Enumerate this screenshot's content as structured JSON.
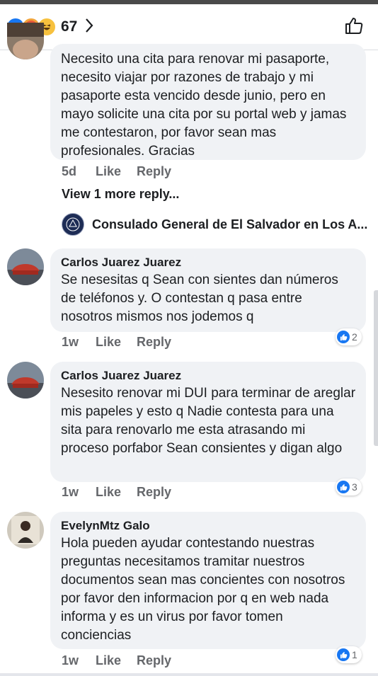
{
  "header": {
    "reaction_count": "67",
    "reactions": [
      "like-icon",
      "angry-icon",
      "haha-icon"
    ]
  },
  "comments": [
    {
      "text": "Necesito una cita para renovar mi pasaporte, necesito viajar por razones de trabajo y mi pasaporte esta vencido desde junio, pero en mayo solicite una cita por su portal web y jamas me contestaron, por favor sean mas profesionales. Gracias",
      "time": "5d",
      "like": "Like",
      "reply": "Reply"
    },
    {
      "author": "Carlos Juarez Juarez",
      "text": "Se nesesitas q Sean con sientes dan números de teléfonos y. O contestan q pasa entre nosotros mismos nos jodemos q",
      "time": "1w",
      "like": "Like",
      "reply": "Reply",
      "reactions": "2"
    },
    {
      "author": "Carlos Juarez Juarez",
      "text": "Nesesito renovar mi DUI para terminar de areglar mis papeles y esto q Nadie contesta para una sita para renovarlo me esta atrasando mi proceso porfabor Sean consientes y digan algo",
      "time": "1w",
      "like": "Like",
      "reply": "Reply",
      "reactions": "3"
    },
    {
      "author": "EvelynMtz Galo",
      "text": "Hola pueden ayudar  contestando nuestras preguntas necesitamos tramitar nuestros documentos sean mas concientes con nosotros por favor den informacion por q en web nada informa y es un virus  por favor tomen conciencias",
      "time": "1w",
      "like": "Like",
      "reply": "Reply",
      "reactions": "1"
    }
  ],
  "view_more_replies": "View 1 more reply...",
  "page_reply": {
    "name": "Consulado General de El Salvador en Los A..."
  },
  "colors": {
    "like_blue": "#1877f2",
    "bubble_bg": "#f0f2f5",
    "meta_gray": "#65676b"
  }
}
